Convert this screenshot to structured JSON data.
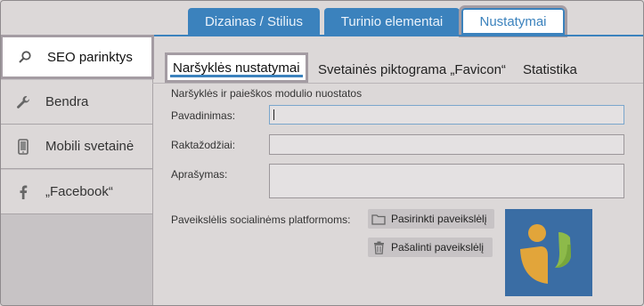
{
  "top_tabs": [
    {
      "label": "Dizainas / Stilius"
    },
    {
      "label": "Turinio elementai"
    },
    {
      "label": "Nustatymai",
      "active": true
    }
  ],
  "sidebar": {
    "items": [
      {
        "label": "SEO parinktys",
        "icon": "search-icon",
        "active": true
      },
      {
        "label": "Bendra",
        "icon": "wrench-icon"
      },
      {
        "label": "Mobili svetainė",
        "icon": "mobile-phone-icon"
      },
      {
        "label": "„Facebook“",
        "icon": "facebook-icon"
      }
    ]
  },
  "sub_tabs": [
    {
      "label": "Naršyklės nustatymai",
      "active": true
    },
    {
      "label": "Svetainės piktograma „Favicon“"
    },
    {
      "label": "Statistika"
    }
  ],
  "form": {
    "section_title": "Naršyklės ir paieškos modulio nuostatos",
    "title_label": "Pavadinimas:",
    "title_value": "",
    "keywords_label": "Raktažodžiai:",
    "keywords_value": "",
    "description_label": "Aprašymas:",
    "description_value": "",
    "social_image_label": "Paveikslėlis socialinėms platformoms:",
    "choose_image_button": "Pasirinkti paveikslėlį",
    "remove_image_button": "Pašalinti paveikslėlį"
  },
  "colors": {
    "accent": "#3b82bd",
    "logo_bg": "#3a6da4",
    "logo_orange": "#e2a53a",
    "logo_green": "#8dba4a"
  }
}
